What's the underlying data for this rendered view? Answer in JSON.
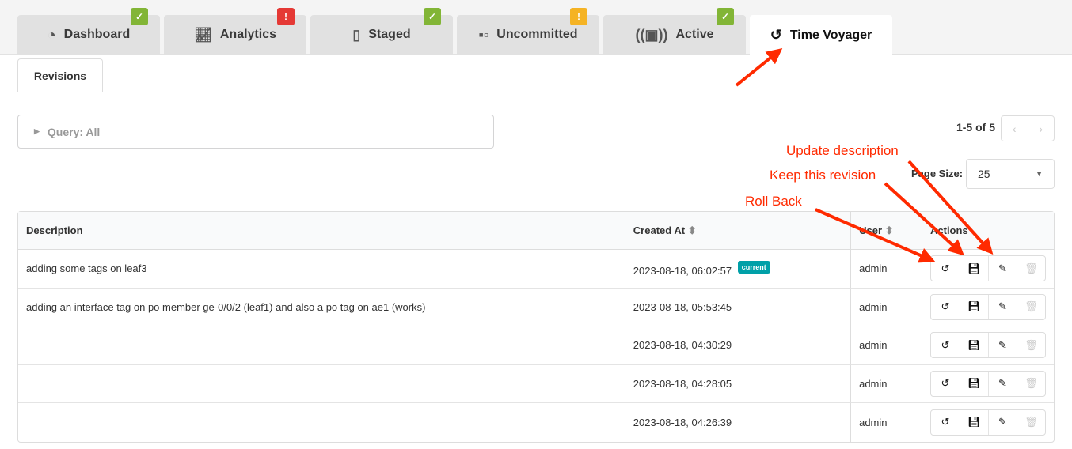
{
  "tabs": [
    {
      "label": "Dashboard",
      "icon": "gauge-icon",
      "status": "ok"
    },
    {
      "label": "Analytics",
      "icon": "chart-line-icon",
      "status": "error"
    },
    {
      "label": "Staged",
      "icon": "file-icon",
      "status": "ok"
    },
    {
      "label": "Uncommitted",
      "icon": "boxes-icon",
      "status": "warning"
    },
    {
      "label": "Active",
      "icon": "broadcast-icon",
      "status": "ok"
    },
    {
      "label": "Time Voyager",
      "icon": "history-icon",
      "status": null
    }
  ],
  "subtab": "Revisions",
  "query": "Query: All",
  "pagination": {
    "info": "1-5 of 5",
    "page_size_label": "Page Size:",
    "page_size": "25"
  },
  "table": {
    "headers": [
      "Description",
      "Created At",
      "User",
      "Actions"
    ],
    "current_badge": "current",
    "rows": [
      {
        "description": "adding some tags on leaf3",
        "created": "2023-08-18, 06:02:57",
        "user": "admin",
        "current": true
      },
      {
        "description": "adding an interface tag on po member ge-0/0/2 (leaf1) and also a po tag on ae1 (works)",
        "created": "2023-08-18, 05:53:45",
        "user": "admin"
      },
      {
        "description": "",
        "created": "2023-08-18, 04:30:29",
        "user": "admin"
      },
      {
        "description": "",
        "created": "2023-08-18, 04:28:05",
        "user": "admin"
      },
      {
        "description": "",
        "created": "2023-08-18, 04:26:39",
        "user": "admin"
      }
    ]
  },
  "annotations": {
    "update": "Update description",
    "keep": "Keep this revision",
    "rollback": "Roll Back"
  },
  "colors": {
    "ok": "#82b536",
    "error": "#e53935",
    "warning": "#f5b324",
    "current": "#00a0a8",
    "annotation": "#ff2a00"
  }
}
